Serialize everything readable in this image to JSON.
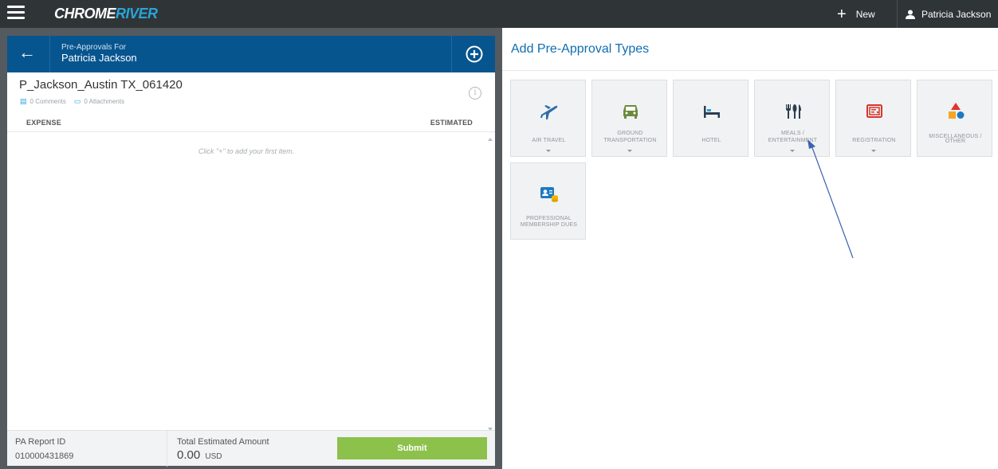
{
  "topbar": {
    "logo_part1": "CHROME",
    "logo_part2": "RIVER",
    "new_label": "New",
    "user_name": "Patricia Jackson"
  },
  "left_panel": {
    "header_subtitle": "Pre-Approvals For",
    "header_name": "Patricia Jackson",
    "report_title": "P_Jackson_Austin TX_061420",
    "comments": "0 Comments",
    "attachments": "0 Attachments",
    "col_expense": "EXPENSE",
    "col_estimated": "ESTIMATED",
    "empty_hint": "Click \"+\" to add your first item.",
    "footer": {
      "report_id_label": "PA Report ID",
      "report_id_value": "010000431869",
      "total_label": "Total Estimated Amount",
      "total_value": "0.00",
      "currency": "USD",
      "submit_label": "Submit"
    }
  },
  "right_panel": {
    "title": "Add Pre-Approval Types",
    "tiles": [
      {
        "line1": "",
        "line2": "AIR TRAVEL",
        "icon": "airplane-icon",
        "dropdown": true
      },
      {
        "line1": "GROUND",
        "line2": "TRANSPORTATION",
        "icon": "car-icon",
        "dropdown": true
      },
      {
        "line1": "",
        "line2": "HOTEL",
        "icon": "bed-icon",
        "dropdown": false
      },
      {
        "line1": "MEALS /",
        "line2": "ENTERTAINMENT",
        "icon": "utensils-icon",
        "dropdown": true
      },
      {
        "line1": "",
        "line2": "REGISTRATION",
        "icon": "registration-icon",
        "dropdown": true
      },
      {
        "line1": "MISCELLANEOUS /",
        "line2": "OTHER",
        "icon": "shapes-icon",
        "dropdown": false
      },
      {
        "line1": "PROFESSIONAL",
        "line2": "MEMBERSHIP DUES",
        "icon": "membership-icon",
        "dropdown": false
      }
    ]
  },
  "colors": {
    "topbar": "#2f3437",
    "header_blue": "#07558f",
    "title_blue": "#0f6eb0",
    "submit_green": "#8cc14c",
    "annotation_arrow": "#3a62b0"
  }
}
